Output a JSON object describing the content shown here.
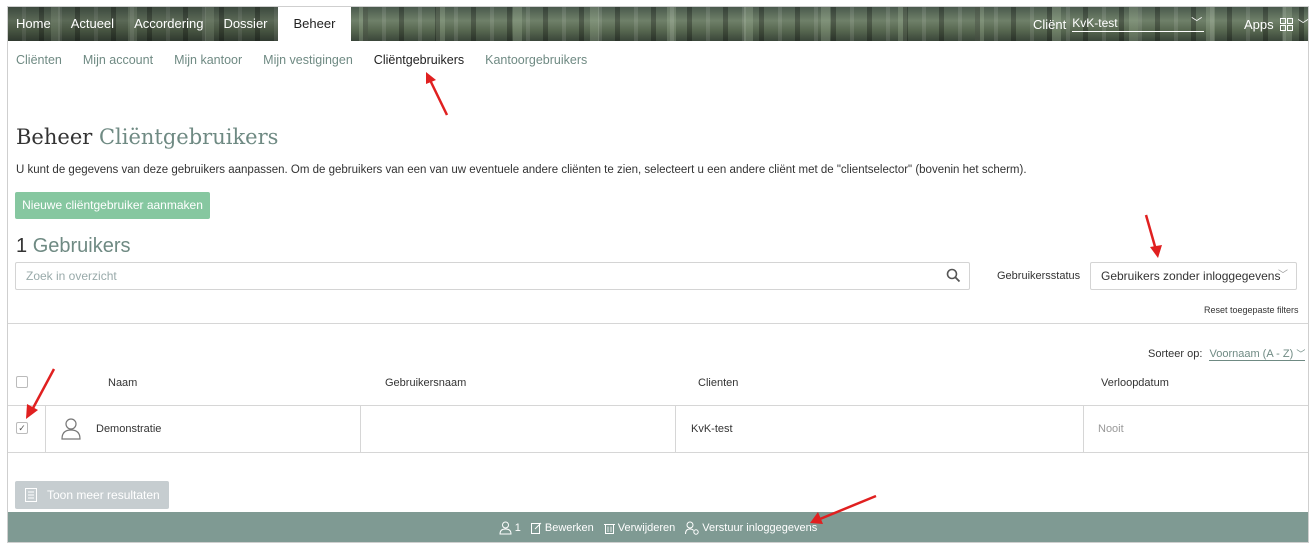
{
  "topnav": {
    "items": [
      "Home",
      "Actueel",
      "Accordering",
      "Dossier",
      "Beheer"
    ],
    "active": "Beheer",
    "client_label": "Cliënt",
    "client_value": "KvK-test",
    "apps_label": "Apps"
  },
  "subnav": {
    "items": [
      "Cliënten",
      "Mijn account",
      "Mijn kantoor",
      "Mijn vestigingen",
      "Cliëntgebruikers",
      "Kantoorgebruikers"
    ],
    "active": "Cliëntgebruikers"
  },
  "page": {
    "title_prefix": "Beheer",
    "title_accent": "Cliëntgebruikers",
    "description": "U kunt de gegevens van deze gebruikers aanpassen. Om de gebruikers van een van uw eventuele andere cliënten te zien, selecteert u een andere cliënt met de \"clientselector\" (bovenin het scherm).",
    "new_button": "Nieuwe cliëntgebruiker aanmaken",
    "count_number": "1",
    "count_label": "Gebruikers"
  },
  "filters": {
    "search_placeholder": "Zoek in overzicht",
    "status_label": "Gebruikersstatus",
    "status_value": "Gebruikers zonder inloggegevens",
    "reset_label": "Reset toegepaste filters",
    "sort_label": "Sorteer op:",
    "sort_value": "Voornaam (A - Z)"
  },
  "table": {
    "columns": [
      "Naam",
      "Gebruikersnaam",
      "Clienten",
      "Verloopdatum"
    ],
    "rows": [
      {
        "naam": "Demonstratie",
        "gebruikersnaam": "",
        "clienten": "KvK-test",
        "verloopdatum": "Nooit",
        "checked": true
      }
    ]
  },
  "more_button": "Toon meer resultaten",
  "actionbar": {
    "selected_count": "1",
    "edit": "Bewerken",
    "delete": "Verwijderen",
    "send": "Verstuur inloggegevens"
  },
  "colors": {
    "accent": "#6f8a83",
    "new_button": "#86c7a0",
    "actionbar": "#7f9a93",
    "annotation_arrow": "#e02020"
  },
  "icons": [
    "grid-icon",
    "search-icon",
    "user-icon",
    "edit-icon",
    "trash-icon",
    "send-credentials-icon",
    "list-icon",
    "check-icon",
    "chevron-down-icon"
  ]
}
